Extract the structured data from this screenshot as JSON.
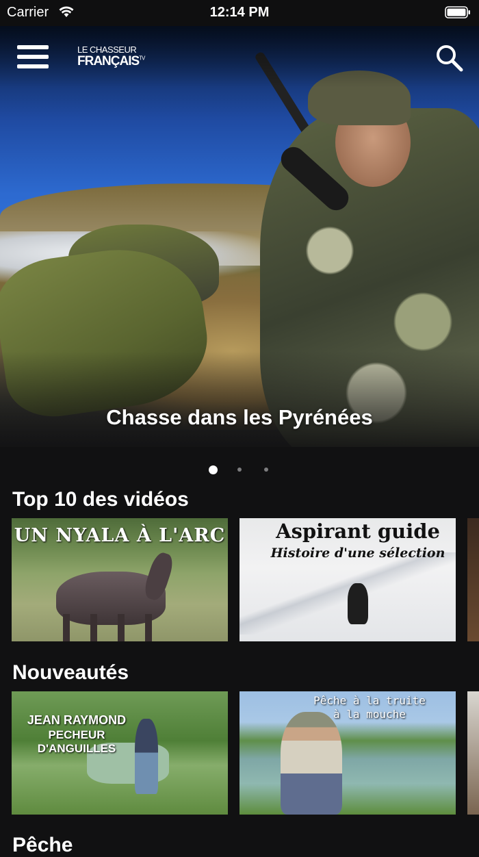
{
  "status_bar": {
    "carrier": "Carrier",
    "time": "12:14 PM"
  },
  "header": {
    "logo_line1": "LE CHASSEUR",
    "logo_line2": "FRANÇAIS",
    "logo_tv": "TV"
  },
  "hero": {
    "title": "Chasse dans les Pyrénées",
    "active_page": 1,
    "page_count": 3
  },
  "sections": [
    {
      "title": "Top 10 des vidéos",
      "cards": [
        {
          "caption": "UN NYALA À L'ARC"
        },
        {
          "caption": "Aspirant guide",
          "subcaption": "Histoire d'une sélection"
        }
      ]
    },
    {
      "title": "Nouveautés",
      "cards": [
        {
          "caption": "JEAN  RAYMOND",
          "subcaption": "PECHEUR D'ANGUILLES"
        },
        {
          "caption": "Pêche à la truite",
          "subcaption": "à la mouche"
        }
      ]
    },
    {
      "title": "Pêche"
    }
  ],
  "colors": {
    "background": "#111112",
    "text": "#ffffff",
    "dot_active": "#ffffff",
    "dot_inactive": "#7d7d7f"
  }
}
